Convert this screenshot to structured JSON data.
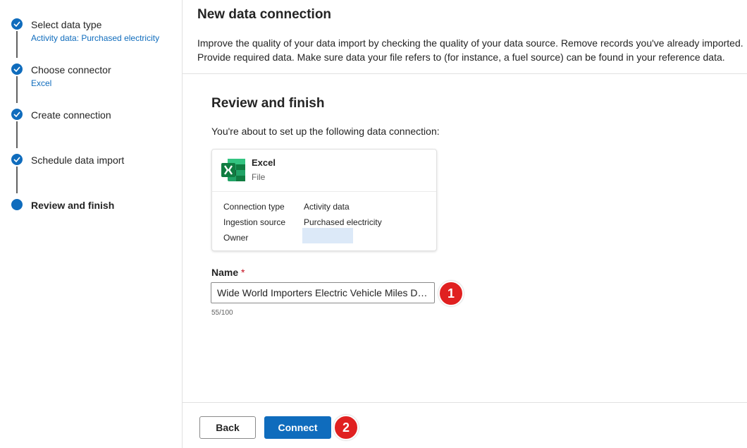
{
  "stepper": {
    "steps": [
      {
        "title": "Select data type",
        "subtitle": "Activity data: Purchased electricity",
        "state": "completed"
      },
      {
        "title": "Choose connector",
        "subtitle": "Excel",
        "state": "completed"
      },
      {
        "title": "Create connection",
        "subtitle": "",
        "state": "completed"
      },
      {
        "title": "Schedule data import",
        "subtitle": "",
        "state": "completed"
      },
      {
        "title": "Review and finish",
        "subtitle": "",
        "state": "current"
      }
    ]
  },
  "header": {
    "title": "New data connection",
    "description_line1": "Improve the quality of your data import by checking the quality of your data source. Remove records you've already imported.",
    "description_line2": "Provide required data. Make sure data your file refers to (for instance, a fuel source) can be found in your reference data."
  },
  "review": {
    "title": "Review and finish",
    "intro": "You're about to set up the following data connection:",
    "card": {
      "icon": "excel-icon",
      "name": "Excel",
      "type": "File",
      "rows": [
        {
          "label": "Connection type",
          "value": "Activity data"
        },
        {
          "label": "Ingestion source",
          "value": "Purchased electricity"
        },
        {
          "label": "Owner",
          "value": ""
        }
      ]
    }
  },
  "name_field": {
    "label": "Name",
    "required_mark": "*",
    "value": "Wide World Importers Electric Vehicle Miles Driven",
    "counter": "55/100"
  },
  "callouts": {
    "first": "1",
    "second": "2"
  },
  "footer": {
    "back_label": "Back",
    "connect_label": "Connect"
  },
  "colors": {
    "accent": "#0f6cbd",
    "callout": "#e02020",
    "excel_green": "#107c41"
  }
}
